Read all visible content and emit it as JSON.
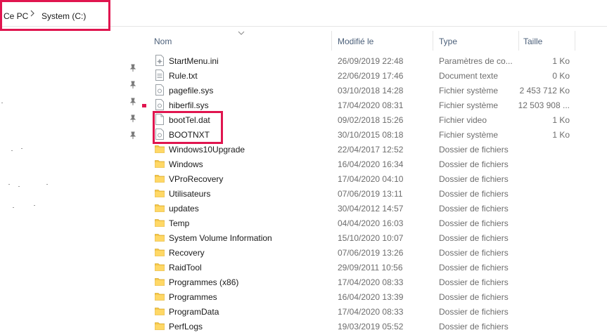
{
  "breadcrumb": {
    "root": "Ce PC",
    "drive": "System (C:)"
  },
  "columns": {
    "name": "Nom",
    "modified": "Modifié le",
    "type": "Type",
    "size": "Taille"
  },
  "accent_color": "#e0154f",
  "folder_color": "#f6c94b",
  "files": [
    {
      "name": "StartMenu.ini",
      "date": "26/09/2019 22:48",
      "type": "Paramètres de co...",
      "size": "1 Ko",
      "icon": "settings-file-icon"
    },
    {
      "name": "Rule.txt",
      "date": "22/06/2019 17:46",
      "type": "Document texte",
      "size": "0 Ko",
      "icon": "text-file-icon"
    },
    {
      "name": "pagefile.sys",
      "date": "03/10/2018 14:28",
      "type": "Fichier système",
      "size": "2 453 712 Ko",
      "icon": "system-file-icon"
    },
    {
      "name": "hiberfil.sys",
      "date": "17/04/2020 08:31",
      "type": "Fichier système",
      "size": "12 503 908 ...",
      "icon": "system-file-icon"
    },
    {
      "name": "bootTel.dat",
      "date": "09/02/2018 15:26",
      "type": "Fichier video",
      "size": "1 Ko",
      "icon": "file-icon"
    },
    {
      "name": "BOOTNXT",
      "date": "30/10/2015 08:18",
      "type": "Fichier système",
      "size": "1 Ko",
      "icon": "system-file-icon"
    },
    {
      "name": "Windows10Upgrade",
      "date": "22/04/2017 12:52",
      "type": "Dossier de fichiers",
      "size": "",
      "icon": "folder-icon"
    },
    {
      "name": "Windows",
      "date": "16/04/2020 16:34",
      "type": "Dossier de fichiers",
      "size": "",
      "icon": "folder-icon"
    },
    {
      "name": "VProRecovery",
      "date": "17/04/2020 04:10",
      "type": "Dossier de fichiers",
      "size": "",
      "icon": "folder-icon"
    },
    {
      "name": "Utilisateurs",
      "date": "07/06/2019 13:11",
      "type": "Dossier de fichiers",
      "size": "",
      "icon": "folder-icon"
    },
    {
      "name": "updates",
      "date": "30/04/2012 14:57",
      "type": "Dossier de fichiers",
      "size": "",
      "icon": "folder-icon"
    },
    {
      "name": "Temp",
      "date": "04/04/2020 16:03",
      "type": "Dossier de fichiers",
      "size": "",
      "icon": "folder-icon"
    },
    {
      "name": "System Volume Information",
      "date": "15/10/2020 10:07",
      "type": "Dossier de fichiers",
      "size": "",
      "icon": "folder-icon"
    },
    {
      "name": "Recovery",
      "date": "07/06/2019 13:26",
      "type": "Dossier de fichiers",
      "size": "",
      "icon": "folder-icon"
    },
    {
      "name": "RaidTool",
      "date": "29/09/2011 10:56",
      "type": "Dossier de fichiers",
      "size": "",
      "icon": "folder-icon"
    },
    {
      "name": "Programmes (x86)",
      "date": "17/04/2020 08:33",
      "type": "Dossier de fichiers",
      "size": "",
      "icon": "folder-icon"
    },
    {
      "name": "Programmes",
      "date": "16/04/2020 13:39",
      "type": "Dossier de fichiers",
      "size": "",
      "icon": "folder-icon"
    },
    {
      "name": "ProgramData",
      "date": "17/04/2020 08:33",
      "type": "Dossier de fichiers",
      "size": "",
      "icon": "folder-icon"
    },
    {
      "name": "PerfLogs",
      "date": "19/03/2019 05:52",
      "type": "Dossier de fichiers",
      "size": "",
      "icon": "folder-icon"
    }
  ]
}
